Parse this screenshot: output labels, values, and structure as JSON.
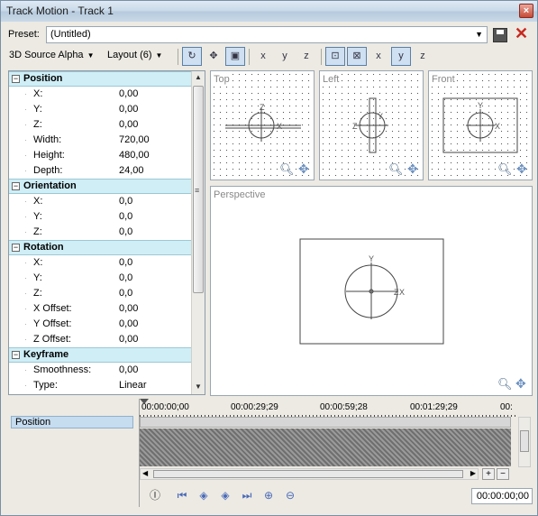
{
  "window": {
    "title": "Track Motion - Track 1",
    "close_glyph": "×"
  },
  "preset": {
    "label": "Preset:",
    "value": "(Untitled)",
    "save_icon": "save-icon",
    "delete_icon": "delete-icon",
    "delete_glyph": "✕"
  },
  "toolbar": {
    "source_alpha": "3D Source Alpha",
    "layout": "Layout (6)",
    "buttons": [
      {
        "name": "rotate-icon",
        "glyph": "↻"
      },
      {
        "name": "move-icon",
        "glyph": "✥"
      },
      {
        "name": "cube-icon",
        "glyph": "▣"
      },
      {
        "name": "scale-x-icon",
        "glyph": "x"
      },
      {
        "name": "scale-y-icon",
        "glyph": "y"
      },
      {
        "name": "scale-z-icon",
        "glyph": "z"
      },
      {
        "name": "snap-frame-icon",
        "glyph": "⊡"
      },
      {
        "name": "fit-icon",
        "glyph": "⊠"
      },
      {
        "name": "lock-x-icon",
        "glyph": "x"
      },
      {
        "name": "lock-y-icon",
        "glyph": "y"
      },
      {
        "name": "lock-z-icon",
        "glyph": "z"
      }
    ]
  },
  "properties": {
    "sections": [
      {
        "title": "Position",
        "rows": [
          {
            "name": "X:",
            "value": "0,00"
          },
          {
            "name": "Y:",
            "value": "0,00"
          },
          {
            "name": "Z:",
            "value": "0,00"
          },
          {
            "name": "Width:",
            "value": "720,00"
          },
          {
            "name": "Height:",
            "value": "480,00"
          },
          {
            "name": "Depth:",
            "value": "24,00"
          }
        ]
      },
      {
        "title": "Orientation",
        "rows": [
          {
            "name": "X:",
            "value": "0,0"
          },
          {
            "name": "Y:",
            "value": "0,0"
          },
          {
            "name": "Z:",
            "value": "0,0"
          }
        ]
      },
      {
        "title": "Rotation",
        "rows": [
          {
            "name": "X:",
            "value": "0,0"
          },
          {
            "name": "Y:",
            "value": "0,0"
          },
          {
            "name": "Z:",
            "value": "0,0"
          },
          {
            "name": "X Offset:",
            "value": "0,00"
          },
          {
            "name": "Y Offset:",
            "value": "0,00"
          },
          {
            "name": "Z Offset:",
            "value": "0,00"
          }
        ]
      },
      {
        "title": "Keyframe",
        "rows": [
          {
            "name": "Smoothness:",
            "value": "0,00"
          },
          {
            "name": "Type:",
            "value": "Linear"
          }
        ]
      }
    ]
  },
  "viewports": {
    "top": "Top",
    "left": "Left",
    "front": "Front",
    "perspective": "Perspective",
    "axes": {
      "x": "X",
      "y": "Y",
      "z": "Z"
    }
  },
  "timeline": {
    "track": "Position",
    "ticks": [
      "00:00:00;00",
      "00:00:29;29",
      "00:00:59;28",
      "00:01:29;29",
      "00:"
    ],
    "timecode": "00:00:00;00",
    "zoom_in": "+",
    "zoom_out": "−"
  },
  "keyframe_buttons": [
    "first-keyframe-icon",
    "prev-keyframe-icon",
    "next-keyframe-icon",
    "last-keyframe-icon",
    "add-keyframe-icon",
    "remove-keyframe-icon"
  ]
}
